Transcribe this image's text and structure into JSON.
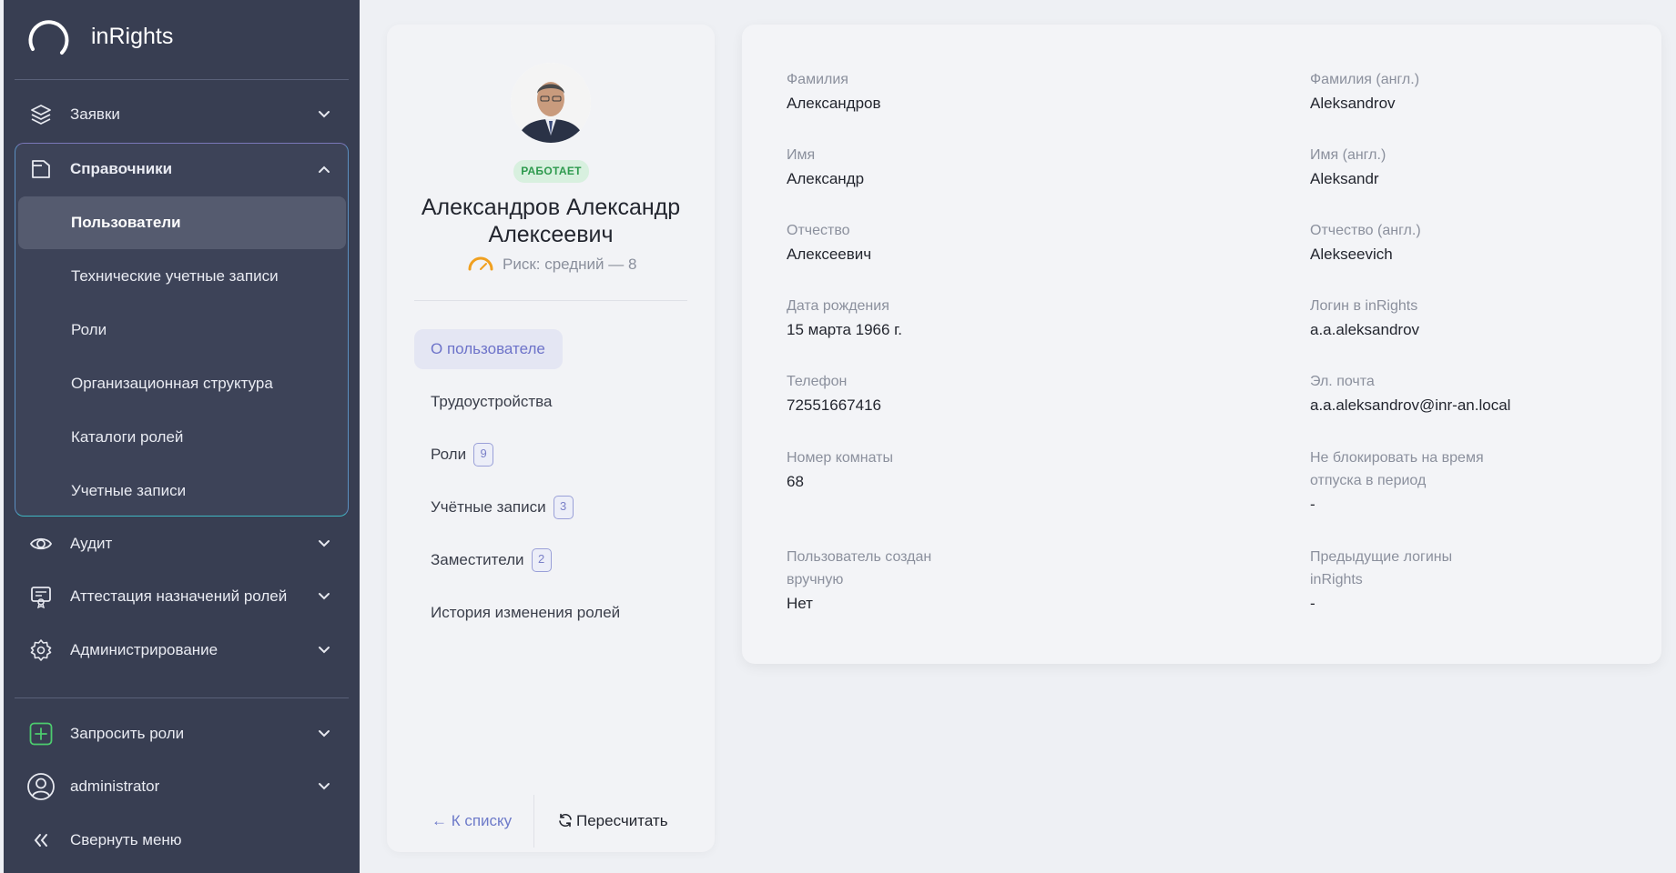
{
  "app": {
    "title": "inRights"
  },
  "sidebar": {
    "requests": {
      "label": "Заявки",
      "icon": "layers-icon"
    },
    "directories": {
      "label": "Справочники",
      "icon": "folder-icon",
      "items": [
        {
          "label": "Пользователи",
          "active": true
        },
        {
          "label": "Технические учетные записи"
        },
        {
          "label": "Роли"
        },
        {
          "label": "Организационная структура"
        },
        {
          "label": "Каталоги ролей"
        },
        {
          "label": "Учетные записи"
        }
      ]
    },
    "audit": {
      "label": "Аудит",
      "icon": "eye-icon"
    },
    "attestation": {
      "label": "Аттестация назначений ролей",
      "icon": "certificate-icon"
    },
    "administration": {
      "label": "Администрирование",
      "icon": "gear-icon"
    },
    "request_roles": {
      "label": "Запросить роли",
      "icon": "plus-icon"
    },
    "user": {
      "label": "administrator",
      "icon": "user-icon"
    },
    "collapse": {
      "label": "Свернуть меню",
      "icon": "double-chevron-left-icon"
    }
  },
  "profile": {
    "status": "РАБОТАЕТ",
    "name": "Александров Александр Алексеевич",
    "risk": "Риск: средний — 8",
    "tabs": [
      {
        "label": "О пользователе",
        "active": true
      },
      {
        "label": "Трудоустройства"
      },
      {
        "label": "Роли",
        "count": "9"
      },
      {
        "label": "Учётные записи",
        "count": "3"
      },
      {
        "label": "Заместители",
        "count": "2"
      },
      {
        "label": "История изменения ролей"
      }
    ],
    "back_label": "← К списку",
    "recalc_label": "Пересчитать"
  },
  "details": {
    "left": [
      {
        "label": "Фамилия",
        "value": "Александров"
      },
      {
        "label": "Имя",
        "value": "Александр"
      },
      {
        "label": "Отчество",
        "value": "Алексеевич"
      },
      {
        "label": "Дата рождения",
        "value": "15 марта 1966 г."
      },
      {
        "label": "Телефон",
        "value": "72551667416"
      },
      {
        "label": "Номер комнаты",
        "value": "68"
      },
      {
        "label": "Пользователь создан вручную",
        "value": "Нет"
      }
    ],
    "right": [
      {
        "label": "Фамилия (англ.)",
        "value": "Aleksandrov"
      },
      {
        "label": "Имя (англ.)",
        "value": "Aleksandr"
      },
      {
        "label": "Отчество (англ.)",
        "value": "Alekseevich"
      },
      {
        "label": "Логин в inRights",
        "value": "a.a.aleksandrov"
      },
      {
        "label": "Эл. почта",
        "value": "a.a.aleksandrov@inr-an.local"
      },
      {
        "label": "Не блокировать на время отпуска в период",
        "value": "-"
      },
      {
        "label": "Предыдущие логины inRights",
        "value": "-"
      }
    ]
  },
  "colors": {
    "sidebar_bg": "#383e52",
    "accent": "#6d73c9",
    "status_green": "#2e9a4e",
    "risk_orange": "#f0a020"
  }
}
